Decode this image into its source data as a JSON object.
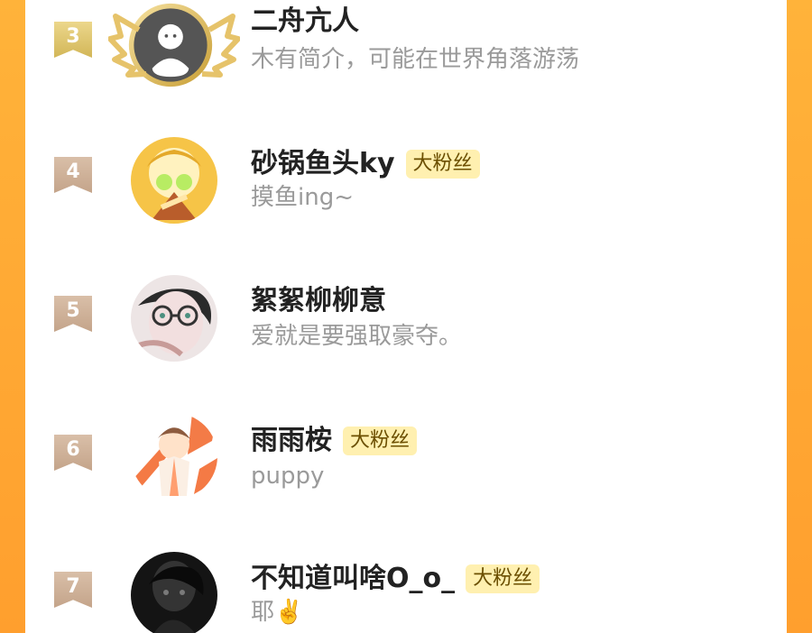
{
  "theme": {
    "background_orange": "#ffb33a",
    "card_white": "#ffffff",
    "badge_bg": "#fff0b0",
    "badge_text": "#6b4f00",
    "rank_gold": "#d2b657",
    "rank_bronze": "#c4a48a",
    "name_text": "#222222",
    "bio_text": "#9a9a9a"
  },
  "leaderboard": {
    "rows": [
      {
        "rank": "3",
        "name": "二舟亢人",
        "badge": "",
        "bio": "木有简介，可能在世界角落游荡",
        "avatar_icon": "default-user-avatar-with-gold-wings"
      },
      {
        "rank": "4",
        "name": "砂锅鱼头ky",
        "badge": "大粉丝",
        "bio": "摸鱼ing~",
        "avatar_icon": "anime-character-avatar"
      },
      {
        "rank": "5",
        "name": "絮絮柳柳意",
        "badge": "",
        "bio": "爱就是要强取豪夺。",
        "avatar_icon": "glasses-character-avatar"
      },
      {
        "rank": "6",
        "name": "雨雨桉",
        "badge": "大粉丝",
        "bio": "puppy",
        "avatar_icon": "illustrated-character-avatar"
      },
      {
        "rank": "7",
        "name": "不知道叫啥O_o_",
        "badge": "大粉丝",
        "bio": "耶✌️",
        "avatar_icon": "dark-photo-avatar"
      }
    ]
  }
}
